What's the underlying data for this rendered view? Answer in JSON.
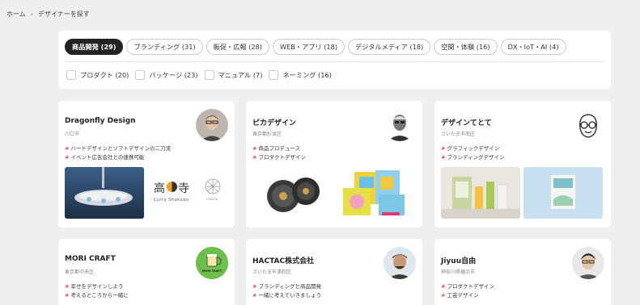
{
  "breadcrumb": {
    "home": "ホーム",
    "separator": "›",
    "current": "デザイナーを探す"
  },
  "categories": [
    {
      "label": "商品開発 (29)",
      "active": true
    },
    {
      "label": "ブランディング (31)",
      "active": false
    },
    {
      "label": "販促・広報 (28)",
      "active": false
    },
    {
      "label": "WEB・アプリ (18)",
      "active": false
    },
    {
      "label": "デジタルメディア (18)",
      "active": false
    },
    {
      "label": "空間・体験 (16)",
      "active": false
    },
    {
      "label": "DX・IoT・AI (4)",
      "active": false
    }
  ],
  "subcategories": [
    "プロダクト (20)",
    "パッケージ (23)",
    "マニュアル (7)",
    "ネーミング (16)"
  ],
  "designers": [
    {
      "name": "Dragonfly Design",
      "location": "川口市",
      "tags": [
        "ハードデザインとソフトデザインの二刀流",
        "イベント広告会社との連携可能"
      ],
      "logo_text": "高",
      "logo_text2": "寺",
      "logo_sub": "Curry Shokudo",
      "logo_small": "COACTA"
    },
    {
      "name": "ピカデザイン",
      "location": "東京都杉並区",
      "tags": [
        "商品プロデュース",
        "プロダクトデザイン"
      ]
    },
    {
      "name": "デザインてとて",
      "location": "さいたま市南区",
      "tags": [
        "グラフィックデザイン",
        "ブランディングデザイン"
      ]
    },
    {
      "name": "MORI CRAFT",
      "location": "東京都中央区",
      "tags": [
        "幸せをデザインしよう",
        "考えるところから一緒に"
      ],
      "badge_text": "MORI CRAFT"
    },
    {
      "name": "HACTAC株式会社",
      "location": "さいたま市浦和区",
      "tags": [
        "ブランディングと商品開発",
        "一緒に考えていきましょう"
      ]
    },
    {
      "name": "Jiyuu自由",
      "location": "神奈川県横浜市",
      "tags": [
        "プロダクトデザイン",
        "工芸デザイン"
      ]
    }
  ],
  "colors": {
    "accent": "#d33333",
    "active_chip": "#222222",
    "background": "#efefef"
  }
}
